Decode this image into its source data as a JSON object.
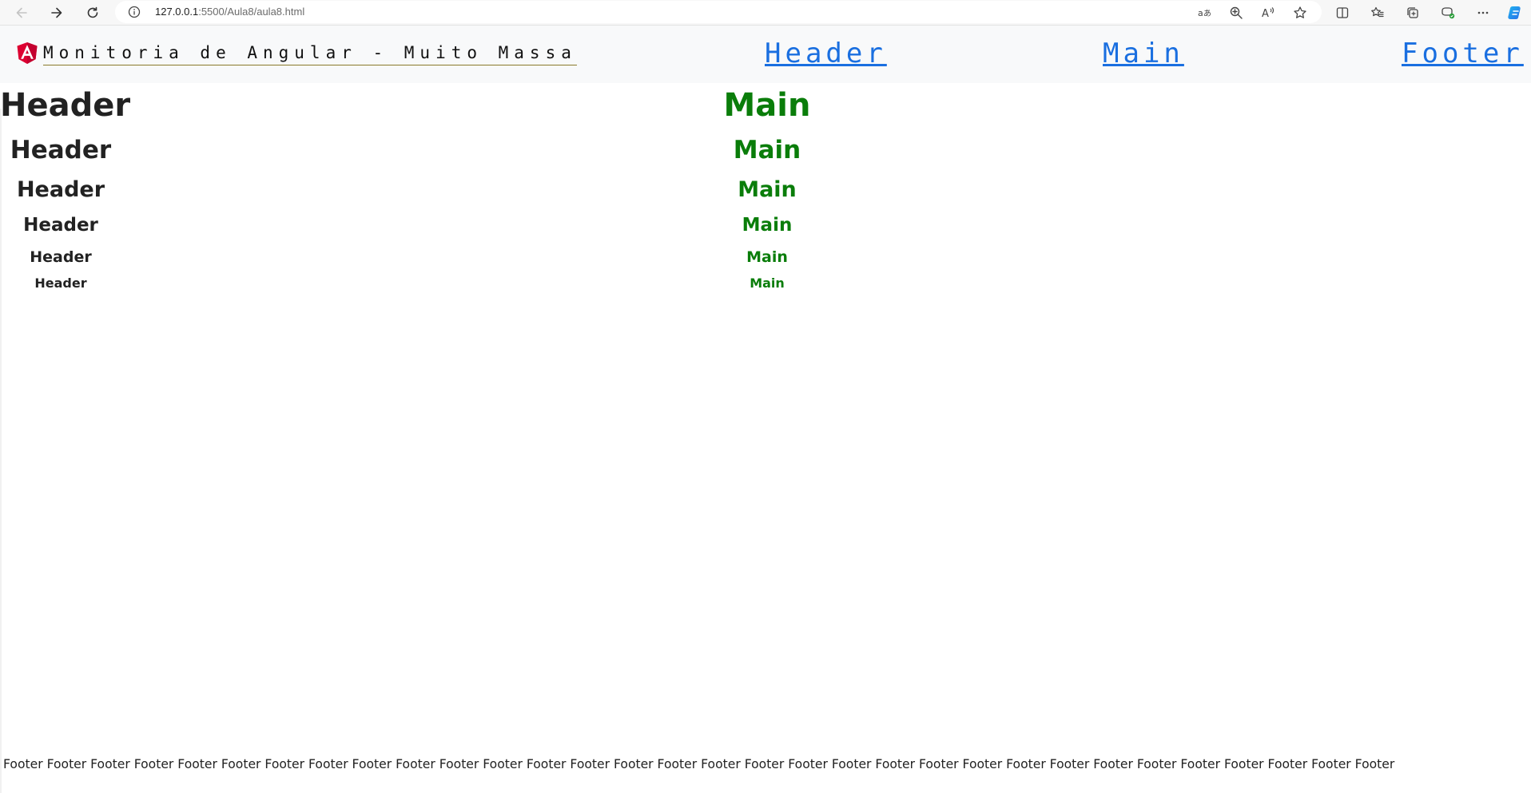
{
  "browser": {
    "url_host": "127.0.0.1",
    "url_path": ":5500/Aula8/aula8.html",
    "icons": [
      "back-icon",
      "forward-icon",
      "refresh-icon",
      "site-info-icon",
      "translate-icon",
      "zoom-icon",
      "read-aloud-icon",
      "favorite-star-icon",
      "split-screen-icon",
      "favorites-icon",
      "collections-icon",
      "extensions-icon",
      "more-icon",
      "copilot-icon"
    ]
  },
  "navbar": {
    "brand": "Monitoria de Angular - Muito Massa",
    "links": [
      "Header",
      "Main",
      "Footer"
    ]
  },
  "header_column": {
    "h1": "Header",
    "h2": "Header",
    "h3": "Header",
    "h4": "Header",
    "h5": "Header",
    "h6": "Header"
  },
  "main_column": {
    "h1": "Main",
    "h2": "Main",
    "h3": "Main",
    "h4": "Main",
    "h5": "Main",
    "h6": "Main"
  },
  "footer": {
    "text": "Footer Footer Footer Footer Footer Footer Footer Footer Footer Footer Footer Footer Footer Footer Footer Footer Footer Footer Footer Footer Footer Footer Footer Footer Footer Footer Footer Footer Footer Footer Footer Footer"
  },
  "colors": {
    "main_heading": "#0a7d0a",
    "nav_link": "#1a6fe0",
    "navbar_bg": "#f8f9fa",
    "angular_red": "#dd0031"
  }
}
